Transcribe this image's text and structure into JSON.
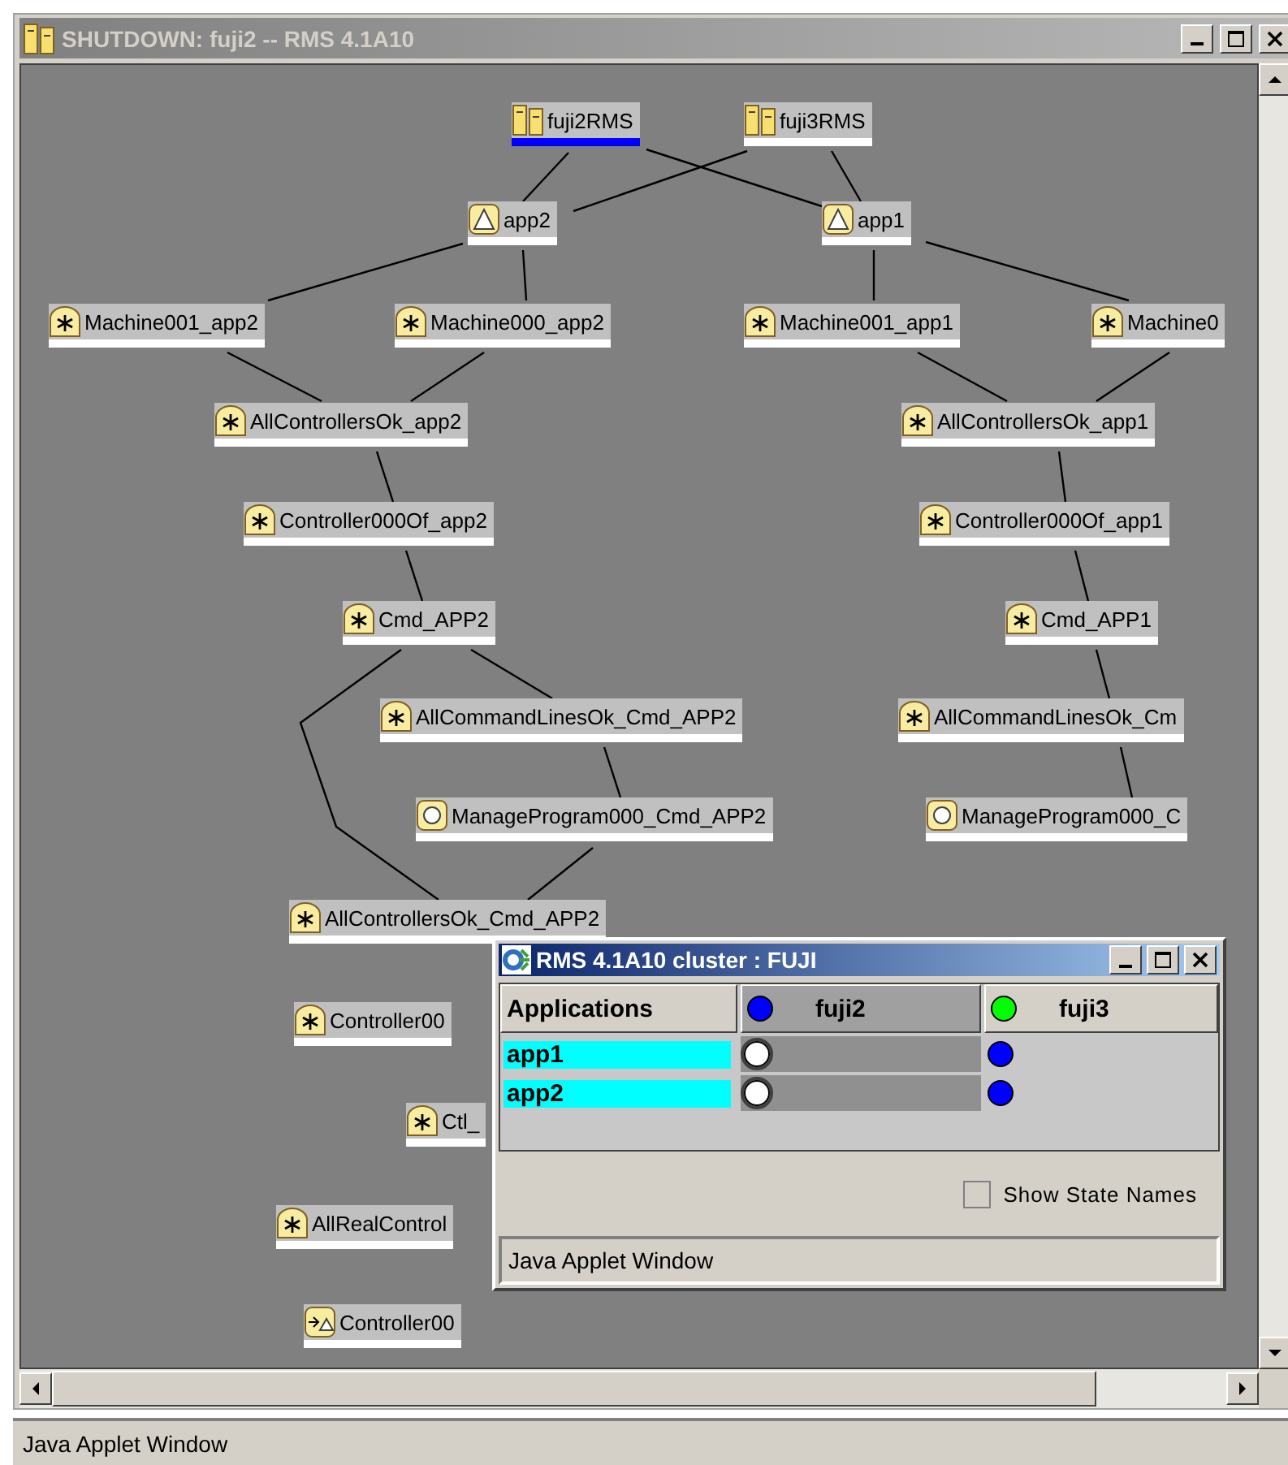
{
  "window": {
    "title": "SHUTDOWN: fuji2 -- RMS 4.1A10"
  },
  "nodes": [
    {
      "label": "fuji2RMS",
      "kind": "host",
      "selected": true
    },
    {
      "label": "fuji3RMS",
      "kind": "host",
      "selected": false
    },
    {
      "label": "app2",
      "kind": "app",
      "selected": false
    },
    {
      "label": "app1",
      "kind": "app",
      "selected": false
    },
    {
      "label": "Machine001_app2",
      "kind": "star",
      "selected": false
    },
    {
      "label": "Machine000_app2",
      "kind": "star",
      "selected": false
    },
    {
      "label": "Machine001_app1",
      "kind": "star",
      "selected": false
    },
    {
      "label": "Machine0",
      "kind": "star",
      "selected": false
    },
    {
      "label": "AllControllersOk_app2",
      "kind": "star",
      "selected": false
    },
    {
      "label": "AllControllersOk_app1",
      "kind": "star",
      "selected": false
    },
    {
      "label": "Controller000Of_app2",
      "kind": "star",
      "selected": false
    },
    {
      "label": "Controller000Of_app1",
      "kind": "star",
      "selected": false
    },
    {
      "label": "Cmd_APP2",
      "kind": "star",
      "selected": false
    },
    {
      "label": "Cmd_APP1",
      "kind": "star",
      "selected": false
    },
    {
      "label": "AllCommandLinesOk_Cmd_APP2",
      "kind": "star",
      "selected": false
    },
    {
      "label": "AllCommandLinesOk_Cm",
      "kind": "star",
      "selected": false
    },
    {
      "label": "ManageProgram000_Cmd_APP2",
      "kind": "circle",
      "selected": false
    },
    {
      "label": "ManageProgram000_C",
      "kind": "circle",
      "selected": false
    },
    {
      "label": "AllControllersOk_Cmd_APP2",
      "kind": "star",
      "selected": false
    },
    {
      "label": "Controller00",
      "kind": "star",
      "selected": false
    },
    {
      "label": "Ctl_",
      "kind": "star",
      "selected": false
    },
    {
      "label": "AllRealControl",
      "kind": "star",
      "selected": false
    },
    {
      "label": "Controller00",
      "kind": "arrow",
      "selected": false
    }
  ],
  "status_bar": "Java Applet Window",
  "cluster_window": {
    "title": "RMS 4.1A10 cluster : FUJI",
    "columns": [
      {
        "label": "Applications",
        "selected": false
      },
      {
        "label": "fuji2",
        "color": "#0000ff",
        "selected": true
      },
      {
        "label": "fuji3",
        "color": "#00ff00",
        "selected": false
      }
    ],
    "rows": [
      {
        "name": "app1",
        "states": [
          {
            "color": "#ffffff"
          },
          {
            "color": "#0000ff"
          }
        ]
      },
      {
        "name": "app2",
        "states": [
          {
            "color": "#ffffff"
          },
          {
            "color": "#0000ff"
          }
        ]
      }
    ],
    "show_state_names": {
      "label": "Show State Names",
      "checked": false
    },
    "status_bar": "Java Applet Window"
  }
}
